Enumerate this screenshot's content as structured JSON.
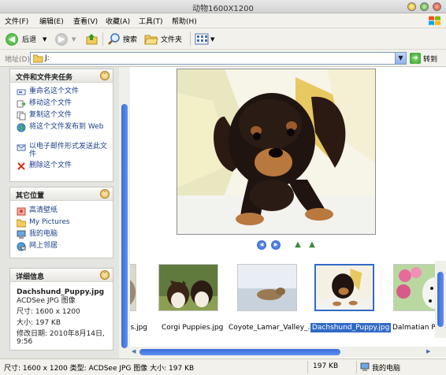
{
  "window": {
    "title": "动物1600X1200"
  },
  "menu": [
    "文件(F)",
    "编辑(E)",
    "查看(V)",
    "收藏(A)",
    "工具(T)",
    "帮助(H)"
  ],
  "toolbar": {
    "back_label": "后退",
    "search_label": "搜索",
    "folders_label": "文件夹"
  },
  "address": {
    "label": "地址(D)",
    "value": "J:",
    "go_label": "转到"
  },
  "tasks_panel": {
    "title": "文件和文件夹任务",
    "items": [
      "重命名这个文件",
      "移动这个文件",
      "复制这个文件",
      "将这个文件发布到 Web",
      "以电子邮件形式发送此文件",
      "删除这个文件"
    ]
  },
  "places_panel": {
    "title": "其它位置",
    "items": [
      "高清壁纸",
      "My Pictures",
      "我的电脑",
      "网上邻居"
    ]
  },
  "details_panel": {
    "title": "详细信息",
    "file_name": "Dachshund_Puppy.jpg",
    "file_type": "ACDSee JPG 图像",
    "dimensions": "尺寸: 1600 x 1200",
    "size": "大小: 197 KB",
    "modified": "修改日期: 2010年8月14日, 9:56"
  },
  "filmstrip": {
    "items": [
      {
        "label": "es.jpg",
        "selected": false
      },
      {
        "label": "Corgi Puppies.jpg",
        "selected": false
      },
      {
        "label": "Coyote_Lamar_Valley_...",
        "selected": false
      },
      {
        "label": "Dachshund_Puppy.jpg",
        "selected": true
      },
      {
        "label": "Dalmatian Pup",
        "selected": false
      }
    ]
  },
  "status": {
    "info": "尺寸: 1600 x 1200 类型: ACDSee JPG 图像 大小: 197 KB",
    "size": "197 KB",
    "location": "我的电脑"
  },
  "colors": {
    "link": "#1a3e8c",
    "selection": "#316ac5",
    "scroll_thumb": "#4a7ee6"
  }
}
